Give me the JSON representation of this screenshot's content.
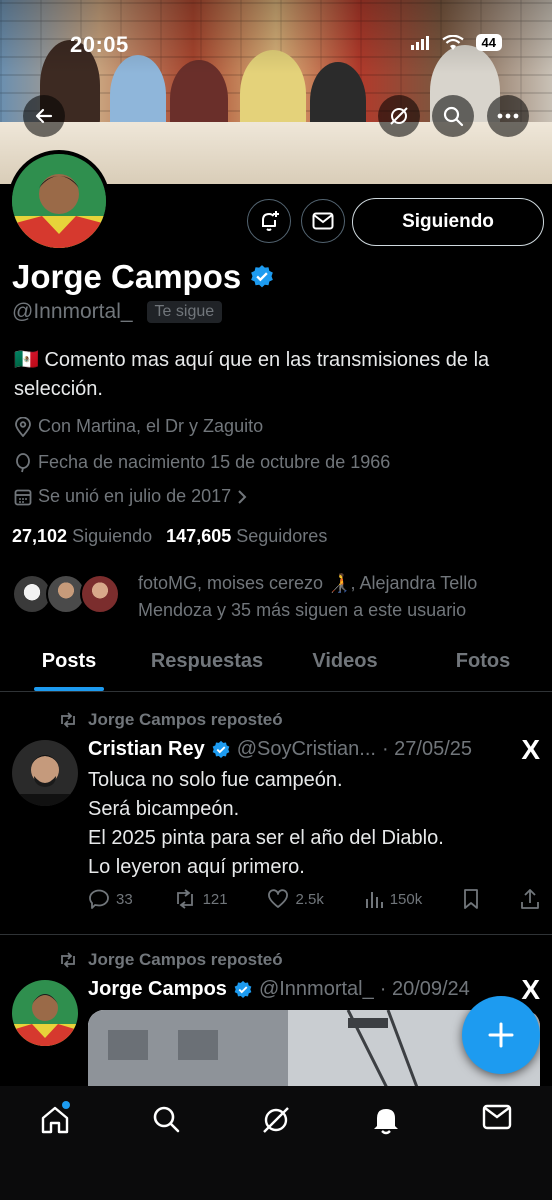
{
  "status_bar": {
    "time": "20:05",
    "battery": "44"
  },
  "profile": {
    "name": "Jorge Campos",
    "handle": "@Innmortal_",
    "follows_you": "Te sigue",
    "follow_button": "Siguiendo",
    "bio": "🇲🇽 Comento mas aquí que en las transmisiones de la selección.",
    "location": "Con Martina, el Dr y Zaguito",
    "birthday": "Fecha de nacimiento 15 de octubre de 1966",
    "joined": "Se unió en julio de 2017",
    "following_count": "27,102",
    "following_label": "Siguiendo",
    "followers_count": "147,605",
    "followers_label": "Seguidores",
    "known_followers": "fotoMG, moises cerezo 🧑‍🦯, Alejandra Tello Mendoza y 35 más siguen a este usuario"
  },
  "tabs": [
    {
      "label": "Posts",
      "active": true
    },
    {
      "label": "Respuestas"
    },
    {
      "label": "Videos"
    },
    {
      "label": "Fotos"
    }
  ],
  "tweets": [
    {
      "repost_label": "Jorge Campos reposteó",
      "author": "Cristian Rey",
      "handle": "@SoyCristian...",
      "date": "· 27/05/25",
      "text_lines": [
        "Toluca no solo fue campeón.",
        "Será bicampeón.",
        "El 2025 pinta para ser el año del Diablo.",
        "Lo leyeron aquí primero."
      ],
      "replies": "33",
      "reposts": "121",
      "likes": "2.5k",
      "views": "150k"
    },
    {
      "repost_label": "Jorge Campos reposteó",
      "author": "Jorge Campos",
      "handle": "@Innmortal_",
      "date": "· 20/09/24"
    }
  ],
  "icons": {
    "back": "arrow-left-icon",
    "grok": "grok-icon",
    "search": "search-icon",
    "more": "more-icon",
    "notify": "bell-plus-icon",
    "message": "envelope-icon",
    "verified": "verified-badge-icon",
    "x_logo": "X"
  },
  "colors": {
    "accent": "#1d9bf0",
    "background": "#000000",
    "muted": "#71767b"
  }
}
